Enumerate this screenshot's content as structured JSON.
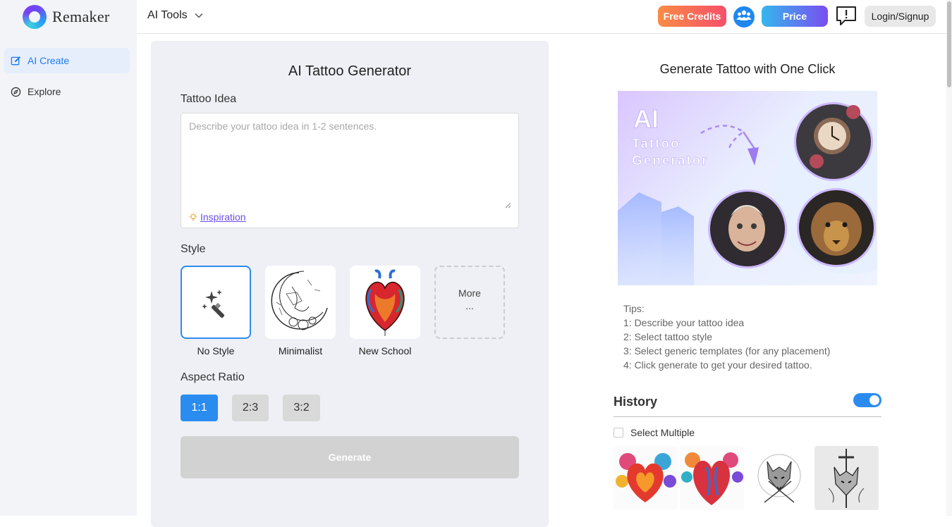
{
  "brand": {
    "name": "Remaker"
  },
  "sidebar": {
    "items": [
      {
        "label": "AI Create",
        "icon": "edit-icon",
        "active": true
      },
      {
        "label": "Explore",
        "icon": "compass-icon",
        "active": false
      }
    ]
  },
  "topbar": {
    "ai_tools": "AI Tools",
    "free_credits": "Free Credits",
    "price": "Price",
    "login": "Login/Signup"
  },
  "generator": {
    "title": "AI Tattoo Generator",
    "idea_label": "Tattoo Idea",
    "idea_placeholder": "Describe your tattoo idea in 1-2 sentences.",
    "inspiration": "Inspiration",
    "style_label": "Style",
    "styles": [
      {
        "name": "No Style",
        "selected": true
      },
      {
        "name": "Minimalist",
        "selected": false
      },
      {
        "name": "New School",
        "selected": false
      }
    ],
    "more": "More",
    "more_dots": "...",
    "aspect_label": "Aspect Ratio",
    "ratios": [
      {
        "label": "1:1",
        "selected": true
      },
      {
        "label": "2:3",
        "selected": false
      },
      {
        "label": "3:2",
        "selected": false
      }
    ],
    "generate": "Generate"
  },
  "right": {
    "title": "Generate Tattoo with One Click",
    "banner": {
      "line1": "AI",
      "line2": "Tattoo",
      "line3": "Generator"
    },
    "tips": [
      "Tips:",
      "1: Describe your tattoo idea",
      "2: Select tattoo style",
      "3: Select generic templates (for any placement)",
      "4: Click generate to get your desired tattoo."
    ],
    "history_title": "History",
    "history_toggle_on": true,
    "select_multiple": "Select Multiple"
  },
  "colors": {
    "accent": "#2b8cf0",
    "free_credits": "#f5506a",
    "price": "#7b4df0"
  }
}
